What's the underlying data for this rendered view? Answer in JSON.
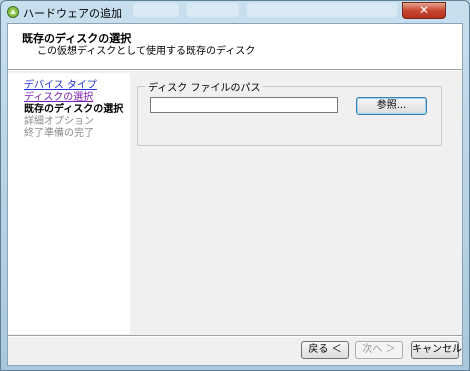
{
  "window": {
    "title": "ハードウェアの追加",
    "close_glyph": "✕"
  },
  "header": {
    "title": "既存のディスクの選択",
    "subtitle": "この仮想ディスクとして使用する既存のディスク"
  },
  "nav": {
    "items": [
      {
        "label": "デバイス タイプ",
        "state": "link"
      },
      {
        "label": "ディスクの選択",
        "state": "visited"
      },
      {
        "label": "既存のディスクの選択",
        "state": "current"
      },
      {
        "label": "詳細オプション",
        "state": "disabled"
      },
      {
        "label": "終了準備の完了",
        "state": "disabled"
      }
    ]
  },
  "disk_path": {
    "group_label": "ディスク ファイルのパス",
    "value": "",
    "browse_label": "参照..."
  },
  "footer": {
    "back_label": "戻る ＜",
    "next_label": "次へ ＞",
    "cancel_label": "キャンセル"
  }
}
